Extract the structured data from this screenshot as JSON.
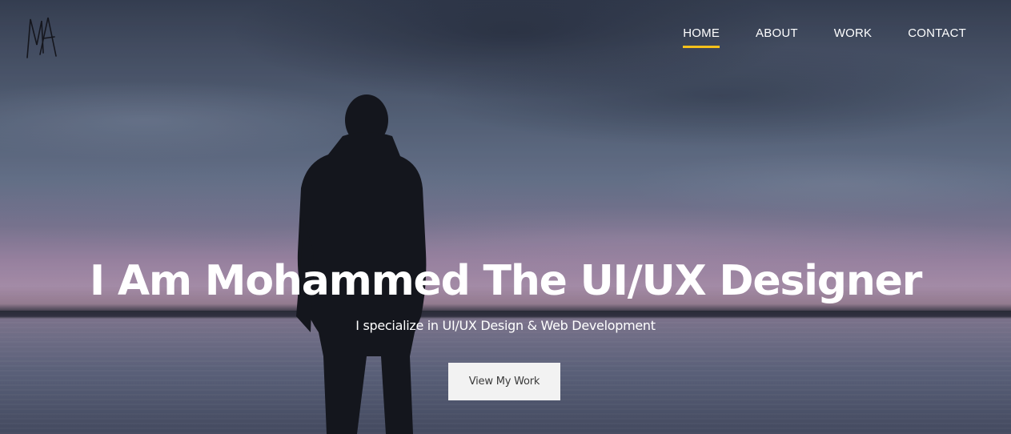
{
  "logo": {
    "text": "MA"
  },
  "nav": {
    "items": [
      {
        "label": "HOME",
        "active": true
      },
      {
        "label": "ABOUT",
        "active": false
      },
      {
        "label": "WORK",
        "active": false
      },
      {
        "label": "CONTACT",
        "active": false
      }
    ],
    "active_indicator_color": "#f5c11b"
  },
  "hero": {
    "headline": "I Am Mohammed The UI/UX Designer",
    "subline": "I specialize in UI/UX Design & Web Development",
    "cta_label": "View My Work"
  }
}
